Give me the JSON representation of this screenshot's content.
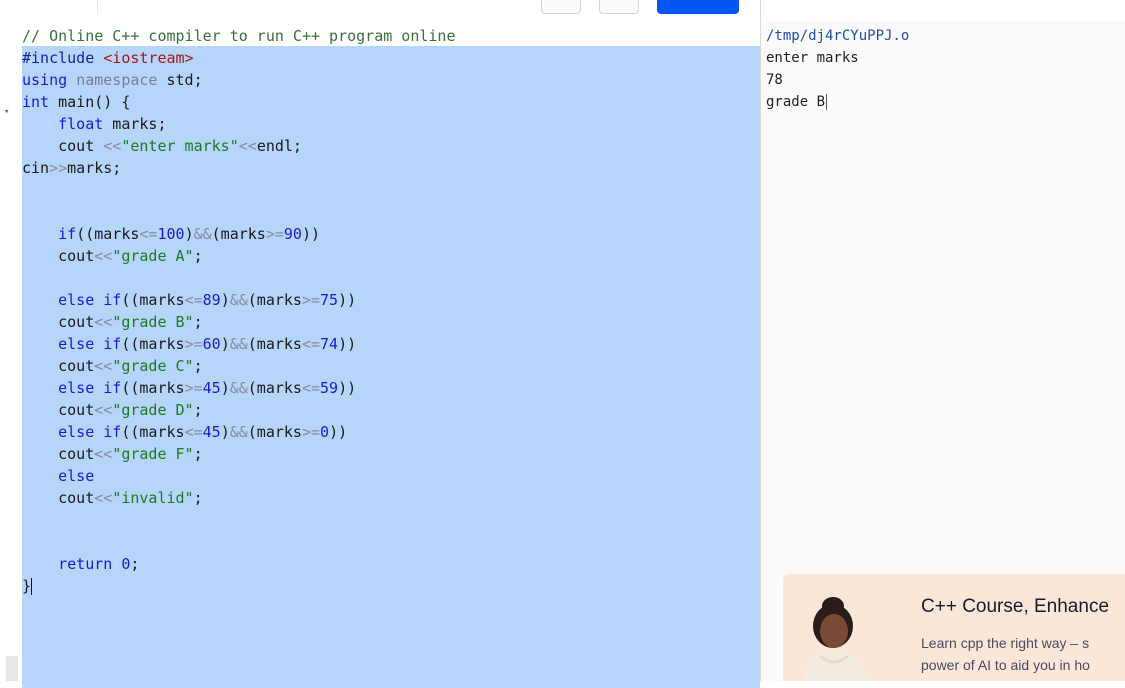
{
  "editor": {
    "lines": [
      "// Online C++ compiler to run C++ program online",
      "#include <iostream>",
      "using namespace std;",
      "int main() {",
      "    float marks;",
      "    cout <<\"enter marks\"<<endl;",
      "cin>>marks;",
      "",
      "",
      "    if((marks<=100)&&(marks>=90))",
      "    cout<<\"grade A\";",
      "",
      "    else if((marks<=89)&&(marks>=75))",
      "    cout<<\"grade B\";",
      "    else if((marks>=60)&&(marks<=74))",
      "    cout<<\"grade C\";",
      "    else if((marks>=45)&&(marks<=59))",
      "    cout<<\"grade D\";",
      "    else if((marks<=45)&&(marks>=0))",
      "    cout<<\"grade F\";",
      "    else",
      "    cout<<\"invalid\";",
      "",
      "",
      "    return 0;",
      "}"
    ]
  },
  "output": {
    "lines": [
      "/tmp/dj4rCYuPPJ.o",
      "enter marks",
      "78",
      "grade B"
    ]
  },
  "ad": {
    "title": "C++ Course, Enhance",
    "text_line1": "Learn cpp the right way – s",
    "text_line2": "power of AI to aid you in ho"
  },
  "colors": {
    "selection": "#b5d5fb",
    "run_button": "#0556f3",
    "ad_background": "#fbe7d8"
  },
  "icons": {
    "fold": "fold-arrow-icon"
  }
}
